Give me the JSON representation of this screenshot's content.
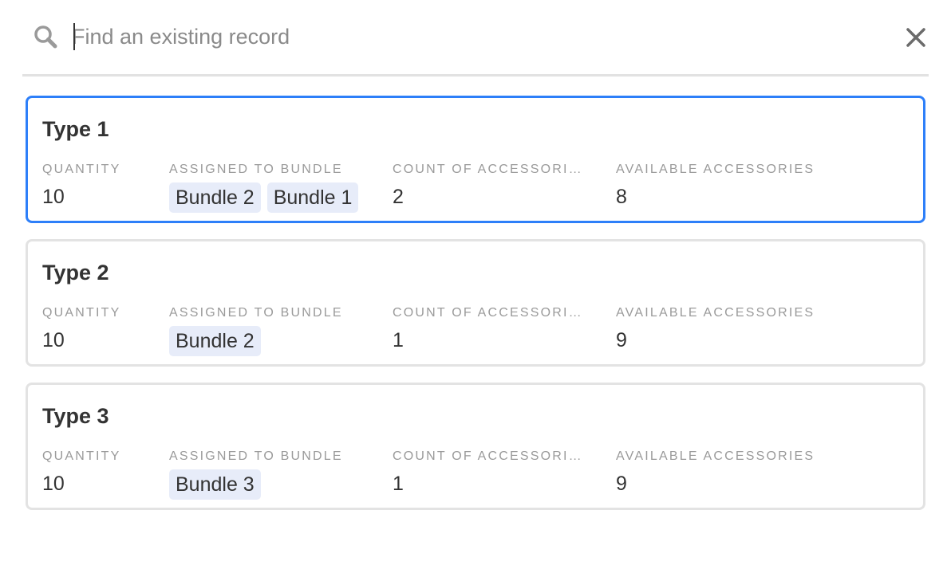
{
  "search": {
    "placeholder": "Find an existing record",
    "value": ""
  },
  "icons": {
    "search": "search-icon",
    "close": "close-icon"
  },
  "colors": {
    "selected_border": "#2d7ff9",
    "chip_background": "#e7ecf9"
  },
  "records": [
    {
      "title": "Type 1",
      "selected": true,
      "labels": {
        "quantity": "QUANTITY",
        "bundle": "ASSIGNED TO BUNDLE",
        "count": "COUNT OF ACCESSORI…",
        "available": "AVAILABLE ACCESSORIES"
      },
      "quantity": "10",
      "bundles": [
        "Bundle 2",
        "Bundle 1"
      ],
      "count": "2",
      "available": "8"
    },
    {
      "title": "Type 2",
      "selected": false,
      "labels": {
        "quantity": "QUANTITY",
        "bundle": "ASSIGNED TO BUNDLE",
        "count": "COUNT OF ACCESSORI…",
        "available": "AVAILABLE ACCESSORIES"
      },
      "quantity": "10",
      "bundles": [
        "Bundle 2"
      ],
      "count": "1",
      "available": "9"
    },
    {
      "title": "Type 3",
      "selected": false,
      "labels": {
        "quantity": "QUANTITY",
        "bundle": "ASSIGNED TO BUNDLE",
        "count": "COUNT OF ACCESSORI…",
        "available": "AVAILABLE ACCESSORIES"
      },
      "quantity": "10",
      "bundles": [
        "Bundle 3"
      ],
      "count": "1",
      "available": "9"
    }
  ]
}
